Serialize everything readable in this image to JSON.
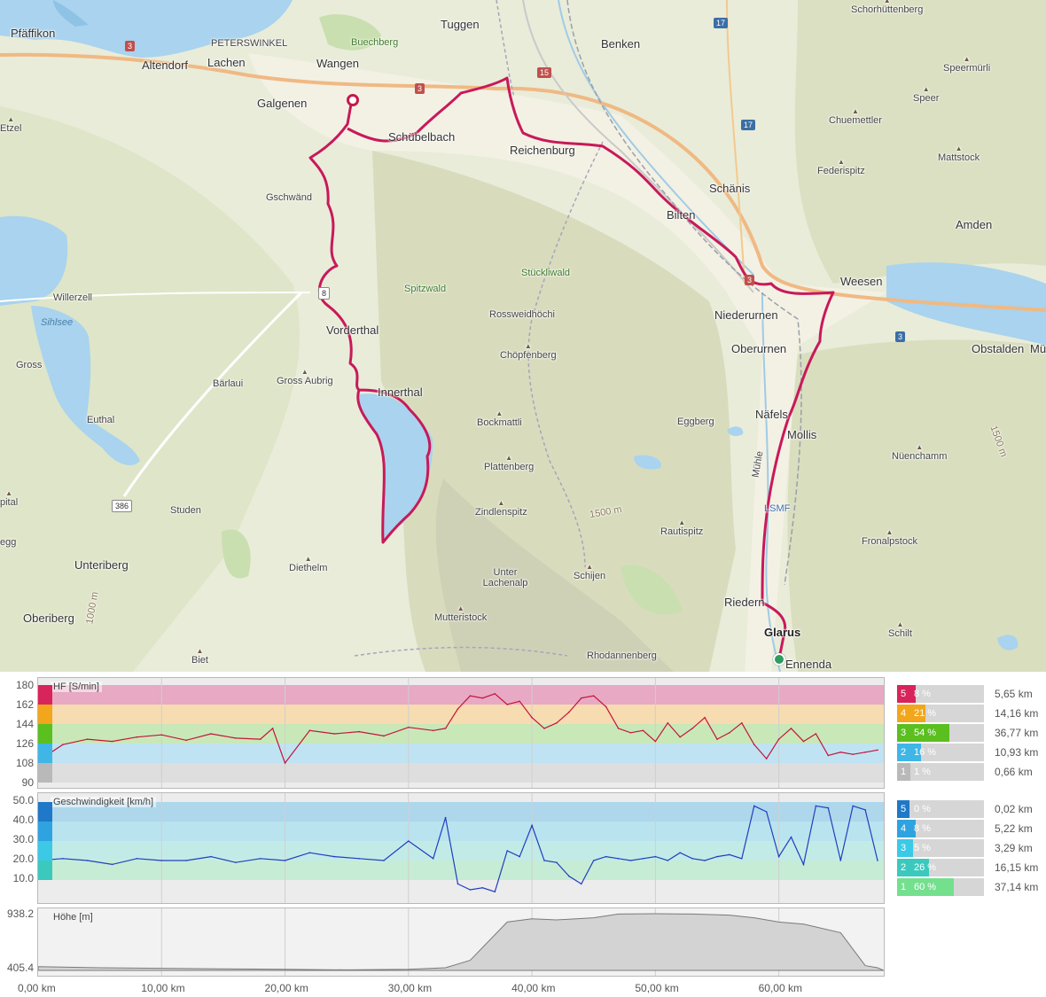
{
  "map": {
    "places": [
      {
        "name": "Pfäffikon",
        "cls": "place"
      },
      {
        "name": "Altendorf",
        "cls": "place"
      },
      {
        "name": "Lachen",
        "cls": "place"
      },
      {
        "name": "Wangen",
        "cls": "place"
      },
      {
        "name": "Tuggen",
        "cls": "place"
      },
      {
        "name": "Benken",
        "cls": "place"
      },
      {
        "name": "Schorhüttenberg",
        "cls": "place small peak"
      },
      {
        "name": "Speermürli",
        "cls": "place small peak"
      },
      {
        "name": "PETERSWINKEL",
        "cls": "place small"
      },
      {
        "name": "Buechberg",
        "cls": "place small green"
      },
      {
        "name": "Galgenen",
        "cls": "place"
      },
      {
        "name": "Schübelbach",
        "cls": "place"
      },
      {
        "name": "Reichenburg",
        "cls": "place"
      },
      {
        "name": "Speer",
        "cls": "place small peak"
      },
      {
        "name": "Chuemettler",
        "cls": "place small peak"
      },
      {
        "name": "Etzel",
        "cls": "place small peak"
      },
      {
        "name": "Mattstock",
        "cls": "place small peak"
      },
      {
        "name": "Federispitz",
        "cls": "place small peak"
      },
      {
        "name": "Schänis",
        "cls": "place"
      },
      {
        "name": "Gschwänd",
        "cls": "place small"
      },
      {
        "name": "Bilten",
        "cls": "place"
      },
      {
        "name": "Amden",
        "cls": "place"
      },
      {
        "name": "Spitzwald",
        "cls": "place green"
      },
      {
        "name": "Stückliwald",
        "cls": "place green"
      },
      {
        "name": "Willerzell",
        "cls": "place small"
      },
      {
        "name": "Weesen",
        "cls": "place"
      },
      {
        "name": "Sihlsee",
        "cls": "place water"
      },
      {
        "name": "Niederurnen",
        "cls": "place"
      },
      {
        "name": "Rossweidhöchi",
        "cls": "place small"
      },
      {
        "name": "Vorderthal",
        "cls": "place"
      },
      {
        "name": "Oberurnen",
        "cls": "place"
      },
      {
        "name": "Obstalden",
        "cls": "place"
      },
      {
        "name": "Mü",
        "cls": "place"
      },
      {
        "name": "Gross",
        "cls": "place small"
      },
      {
        "name": "Chöpfenberg",
        "cls": "place small peak"
      },
      {
        "name": "Bärlaui",
        "cls": "place small"
      },
      {
        "name": "Gross Aubrig",
        "cls": "place small peak"
      },
      {
        "name": "Innerthal",
        "cls": "place"
      },
      {
        "name": "Bockmattli",
        "cls": "place small peak"
      },
      {
        "name": "Eggberg",
        "cls": "place small"
      },
      {
        "name": "Näfels",
        "cls": "place"
      },
      {
        "name": "Mollis",
        "cls": "place"
      },
      {
        "name": "Euthal",
        "cls": "place small"
      },
      {
        "name": "Nüenchamm",
        "cls": "place small peak"
      },
      {
        "name": "Plattenberg",
        "cls": "place small peak"
      },
      {
        "name": "Mühle",
        "cls": "place small"
      },
      {
        "name": "pital",
        "cls": "place small peak"
      },
      {
        "name": "LSMF",
        "cls": "place small"
      },
      {
        "name": "Zindlenspitz",
        "cls": "place small peak"
      },
      {
        "name": "Studen",
        "cls": "place small"
      },
      {
        "name": "Rautispitz",
        "cls": "place small peak"
      },
      {
        "name": "Fronalpstock",
        "cls": "place small peak"
      },
      {
        "name": "egg",
        "cls": "place small"
      },
      {
        "name": "Unteriberg",
        "cls": "place"
      },
      {
        "name": "Diethelm",
        "cls": "place small peak"
      },
      {
        "name": "Unter Lachenalp",
        "cls": "place small"
      },
      {
        "name": "Schijen",
        "cls": "place small peak"
      },
      {
        "name": "Riedern",
        "cls": "place"
      },
      {
        "name": "Oberiberg",
        "cls": "place"
      },
      {
        "name": "Mutteristock",
        "cls": "place small peak"
      },
      {
        "name": "Glarus",
        "cls": "place bold"
      },
      {
        "name": "Schilt",
        "cls": "place small peak"
      },
      {
        "name": "Biet",
        "cls": "place small peak"
      },
      {
        "name": "Rhodannenberg",
        "cls": "place small"
      },
      {
        "name": "Ennenda",
        "cls": "place"
      }
    ],
    "road_badges": [
      {
        "label": "3",
        "cls": "red"
      },
      {
        "label": "3",
        "cls": "red"
      },
      {
        "label": "15",
        "cls": "red"
      },
      {
        "label": "17",
        "cls": "blue"
      },
      {
        "label": "17",
        "cls": "blue"
      },
      {
        "label": "3",
        "cls": "red"
      },
      {
        "label": "3",
        "cls": "blue"
      },
      {
        "label": "8",
        "cls": "white"
      },
      {
        "label": "386",
        "cls": "white"
      }
    ],
    "contour_labels": [
      "1500 m",
      "1500 m",
      "1000 m"
    ]
  },
  "hr_panel": {
    "title": "HF [S/min]",
    "y_ticks": [
      "180",
      "162",
      "144",
      "126",
      "108",
      "90"
    ],
    "zones": [
      {
        "num": "5",
        "pct": "8 %",
        "frac": 0.08,
        "km": "5,65 km",
        "color": "#d9245b"
      },
      {
        "num": "4",
        "pct": "21 %",
        "frac": 0.21,
        "km": "14,16 km",
        "color": "#f2a61c"
      },
      {
        "num": "3",
        "pct": "54 %",
        "frac": 0.54,
        "km": "36,77 km",
        "color": "#5bbf1f"
      },
      {
        "num": "2",
        "pct": "16 %",
        "frac": 0.16,
        "km": "10,93 km",
        "color": "#3fb6e6"
      },
      {
        "num": "1",
        "pct": "1 %",
        "frac": 0.01,
        "km": "0,66 km",
        "color": "#b9b9b9"
      }
    ],
    "band_colors": [
      "#e7a9c3",
      "#f6dcb0",
      "#c9e8b7",
      "#bfe3f2",
      "#dedede"
    ]
  },
  "speed_panel": {
    "title": "Geschwindigkeit [km/h]",
    "y_ticks": [
      "50.0",
      "40.0",
      "30.0",
      "20.0",
      "10.0"
    ],
    "zones": [
      {
        "num": "5",
        "pct": "0 %",
        "frac": 0.0,
        "km": "0,02 km",
        "color": "#1f78c8"
      },
      {
        "num": "4",
        "pct": "8 %",
        "frac": 0.08,
        "km": "5,22 km",
        "color": "#2fa3e0"
      },
      {
        "num": "3",
        "pct": "5 %",
        "frac": 0.05,
        "km": "3,29 km",
        "color": "#3bc9e6"
      },
      {
        "num": "2",
        "pct": "26 %",
        "frac": 0.26,
        "km": "16,15 km",
        "color": "#3cc9bd"
      },
      {
        "num": "1",
        "pct": "60 %",
        "frac": 0.6,
        "km": "37,14 km",
        "color": "#74e08e"
      }
    ],
    "band_colors": [
      "#aed7ec",
      "#b9e3ef",
      "#c2ebe8",
      "#c7ecd5"
    ]
  },
  "elev_panel": {
    "title": "Höhe [m]",
    "y_max": "938.2",
    "y_min": "405.4"
  },
  "chart_data": [
    {
      "type": "line",
      "title": "HF [S/min]",
      "ylim": [
        90,
        180
      ],
      "x_unit": "km",
      "x": [
        0,
        2,
        4,
        6,
        8,
        10,
        12,
        14,
        16,
        18,
        19,
        20,
        22,
        24,
        26,
        28,
        30,
        32,
        33,
        34,
        35,
        36,
        37,
        38,
        39,
        40,
        41,
        42,
        43,
        44,
        45,
        46,
        47,
        48,
        49,
        50,
        51,
        52,
        53,
        54,
        55,
        56,
        57,
        58,
        59,
        60,
        61,
        62,
        63,
        64,
        65,
        66,
        67,
        68
      ],
      "series": [
        {
          "name": "HF",
          "values": [
            110,
            125,
            130,
            128,
            132,
            134,
            129,
            135,
            131,
            130,
            140,
            108,
            138,
            135,
            137,
            133,
            141,
            138,
            140,
            158,
            170,
            168,
            172,
            162,
            165,
            150,
            140,
            145,
            155,
            168,
            170,
            160,
            140,
            136,
            138,
            128,
            145,
            132,
            140,
            150,
            130,
            136,
            145,
            125,
            112,
            130,
            140,
            128,
            135,
            115,
            118,
            116,
            118,
            120
          ]
        }
      ]
    },
    {
      "type": "line",
      "title": "Geschwindigkeit [km/h]",
      "ylim": [
        0,
        50
      ],
      "x_unit": "km",
      "x": [
        0,
        2,
        4,
        6,
        8,
        10,
        12,
        14,
        16,
        18,
        20,
        22,
        24,
        26,
        28,
        30,
        32,
        33,
        34,
        35,
        36,
        37,
        38,
        39,
        40,
        41,
        42,
        43,
        44,
        45,
        46,
        47,
        48,
        49,
        50,
        51,
        52,
        53,
        54,
        55,
        56,
        57,
        58,
        59,
        60,
        61,
        62,
        63,
        64,
        65,
        66,
        67,
        68
      ],
      "series": [
        {
          "name": "Geschwindigkeit",
          "values": [
            20,
            21,
            20,
            18,
            21,
            20,
            20,
            22,
            19,
            21,
            20,
            24,
            22,
            21,
            20,
            30,
            21,
            42,
            8,
            5,
            6,
            4,
            25,
            22,
            38,
            20,
            19,
            12,
            8,
            20,
            22,
            21,
            20,
            21,
            22,
            20,
            24,
            21,
            20,
            22,
            23,
            21,
            48,
            45,
            22,
            32,
            18,
            48,
            47,
            20,
            48,
            46,
            20
          ]
        }
      ]
    },
    {
      "type": "area",
      "title": "Höhe [m]",
      "ylim": [
        405.4,
        938.2
      ],
      "x_unit": "km",
      "x": [
        0,
        5,
        10,
        15,
        20,
        25,
        30,
        33,
        35,
        38,
        40,
        42,
        45,
        47,
        50,
        53,
        56,
        58,
        60,
        62,
        65,
        67,
        68
      ],
      "series": [
        {
          "name": "Höhe",
          "values": [
            440,
            430,
            425,
            420,
            415,
            410,
            415,
            430,
            500,
            860,
            890,
            880,
            900,
            935,
            938,
            935,
            925,
            900,
            860,
            840,
            760,
            450,
            430
          ]
        }
      ]
    }
  ],
  "x_axis": {
    "unit": "km",
    "max_km": 68.5,
    "ticks": [
      "0,00 km",
      "10,00 km",
      "20,00 km",
      "30,00 km",
      "40,00 km",
      "50,00 km",
      "60,00 km"
    ]
  }
}
